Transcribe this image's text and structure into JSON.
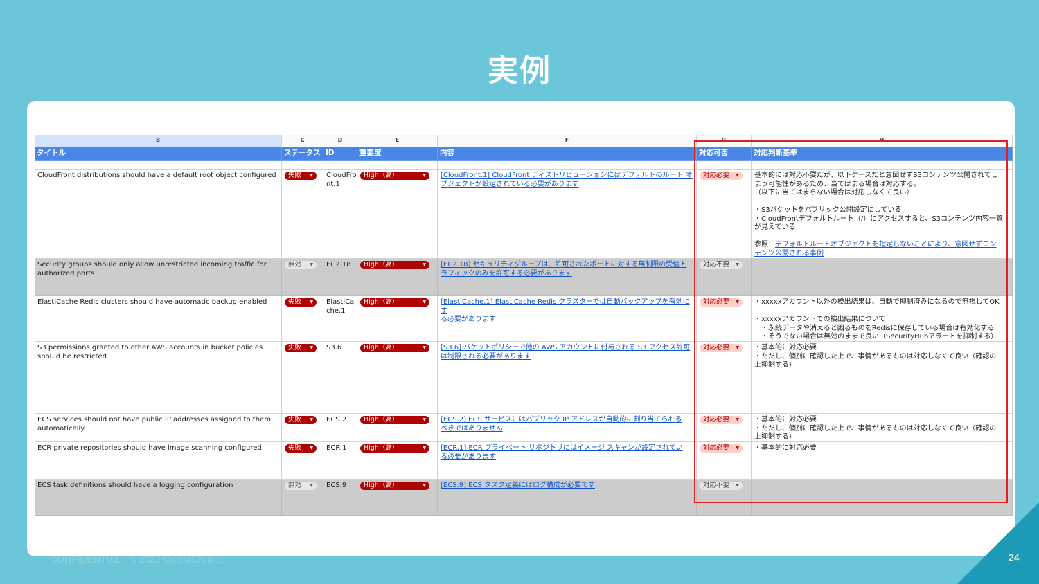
{
  "slide": {
    "title": "実例",
    "footer": "CONFIDENTIAL - © 2022 CoDMON Inc.",
    "page_number": "24"
  },
  "sheet": {
    "column_letters": [
      "B",
      "C",
      "D",
      "E",
      "F",
      "G",
      "H"
    ],
    "headers": [
      "タイトル",
      "ステータス",
      "ID",
      "重要度",
      "内容",
      "対応可否",
      "対応判断基準"
    ],
    "rows": [
      {
        "title": "CloudFront distributions should have a default root object configured",
        "status": "失敗",
        "id_lines": [
          "CloudFro",
          "nt.1"
        ],
        "severity": "High（高）",
        "content_lines": [
          "[CloudFront.1] CloudFront ディストリビューションにはデフォルトのルート オ",
          "ブジェクトが設定されている必要があります"
        ],
        "decision": "対応必要",
        "criteria_lines": [
          "基本的には対応不要だが、以下ケースだと意図せずS3コンテンツ公開されてし",
          "まう可能性があるため、当てはまる場合は対応する。",
          "（以下に当てはまらない場合は対応しなくて良い）",
          "",
          "・S3バケットをパブリック公開設定にしている",
          "・CloudFrontデフォルトルート（/）にアクセスすると、S3コンテンツ内容一覧",
          "が見えている",
          ""
        ],
        "criteria_ref_label": "参照：",
        "criteria_ref_lines": [
          "デフォルトルートオブジェクトを指定しないことにより、意図せずコン",
          "テンツ公開される事例"
        ]
      },
      {
        "title": "Security groups should only allow unrestricted incoming traffic for authorized ports",
        "status": "無効",
        "id_lines": [
          "EC2.18"
        ],
        "severity": "High（高）",
        "content_lines": [
          "[EC2.18] セキュリティグループは、許可されたポートに対する無制限の受信ト",
          "ラフィックのみを許可する必要があります"
        ],
        "decision": "対応不要",
        "criteria_lines": []
      },
      {
        "title": "ElastiCache Redis clusters should have automatic backup enabled",
        "status": "失敗",
        "id_lines": [
          "ElastiCa",
          "che.1"
        ],
        "severity": "High（高）",
        "content_lines": [
          "[ElastiCache.1] ElastiCache Redis クラスターでは自動バックアップを有効にす",
          "る必要があります"
        ],
        "decision": "対応必要",
        "criteria_lines": [
          "・xxxxxアカウント以外の検出結果は、自動で抑制済みになるので無視してOK",
          "",
          "・xxxxxアカウントでの検出結果について",
          "　・永続データや消えると困るものをRedisに保存している場合は有効化する",
          "　・そうでない場合は無効のままで良い（SecurityHubアラートを抑制する）"
        ]
      },
      {
        "title": "S3 permissions granted to other AWS accounts in bucket policies should be restricted",
        "status": "失敗",
        "id_lines": [
          "S3.6"
        ],
        "severity": "High（高）",
        "content_lines": [
          "[S3.6] バケットポリシーで他の AWS アカウントに付与される S3 アクセス許可",
          "は制限される必要があります"
        ],
        "decision": "対応必要",
        "criteria_lines": [
          "・基本的に対応必要",
          "・ただし、個別に確認した上で、事情があるものは対応しなくて良い（確認の",
          "上抑制する）"
        ]
      },
      {
        "title": "ECS services should not have public IP addresses assigned to them automatically",
        "status": "失敗",
        "id_lines": [
          "ECS.2"
        ],
        "severity": "High（高）",
        "content_lines": [
          "[ECS.2] ECS サービスにはパブリック IP アドレスが自動的に割り当てられる",
          "べきではありません"
        ],
        "decision": "対応必要",
        "criteria_lines": [
          "・基本的に対応必要",
          "・ただし、個別に確認した上で、事情があるものは対応しなくて良い（確認の",
          "上抑制する）"
        ]
      },
      {
        "title": "ECR private repositories should have image scanning configured",
        "status": "失敗",
        "id_lines": [
          "ECR.1"
        ],
        "severity": "High（高）",
        "content_lines": [
          "[ECR.1] ECR プライベート リポジトリにはイメージ スキャンが設定されてい",
          "る必要があります"
        ],
        "decision": "対応必要",
        "criteria_lines": [
          "・基本的に対応必要"
        ]
      },
      {
        "title": "ECS task definitions should have a logging configuration",
        "status": "無効",
        "id_lines": [
          "ECS.9"
        ],
        "severity": "High（高）",
        "content_lines": [
          "[ECS.9] ECS タスク定義にはログ構成が必要です"
        ],
        "decision": "対応不要",
        "criteria_lines": []
      }
    ]
  },
  "colors": {
    "background": "#6ac6d8",
    "header_blue": "#4a86e8",
    "fail_red": "#b10202",
    "highlight_box": "#e02020",
    "corner": "#1d9ab8"
  }
}
